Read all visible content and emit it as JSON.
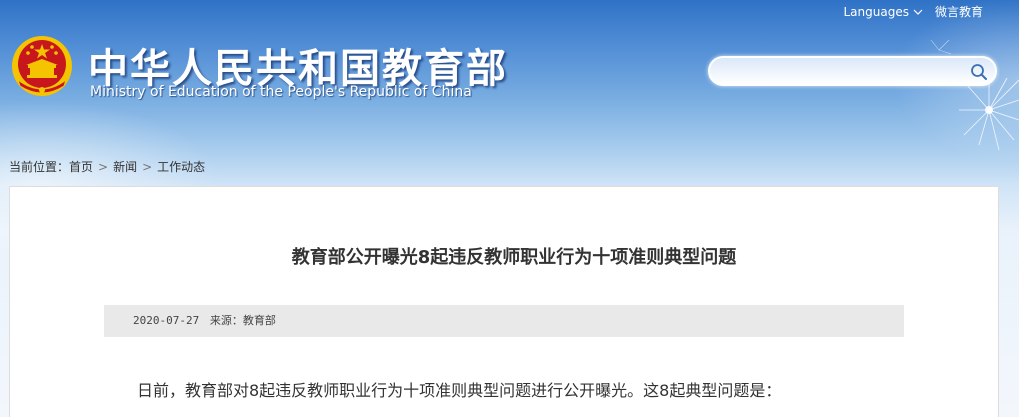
{
  "header": {
    "languages_label": "Languages",
    "wechat_label": "微言教育",
    "site_title_cn": "中华人民共和国教育部",
    "site_title_en": "Ministry of Education of the People's Republic of China",
    "search_placeholder": ""
  },
  "breadcrumb": {
    "prefix": "当前位置：",
    "items": [
      "首页",
      "新闻",
      "工作动态"
    ]
  },
  "article": {
    "title": "教育部公开曝光8起违反教师职业行为十项准则典型问题",
    "date": "2020-07-27",
    "source": "来源：教育部",
    "first_paragraph": "日前，教育部对8起违反教师职业行为十项准则典型问题进行公开曝光。这8起典型问题是："
  },
  "colors": {
    "header_blue": "#2f72c6",
    "emblem_red": "#c8161d",
    "emblem_gold": "#f5c400",
    "meta_bar_bg": "#e9e9e9",
    "text_dark": "#333333"
  },
  "icons": [
    "national-emblem-icon",
    "search-icon",
    "chevron-down-icon",
    "breadcrumb-arrow-icon"
  ]
}
